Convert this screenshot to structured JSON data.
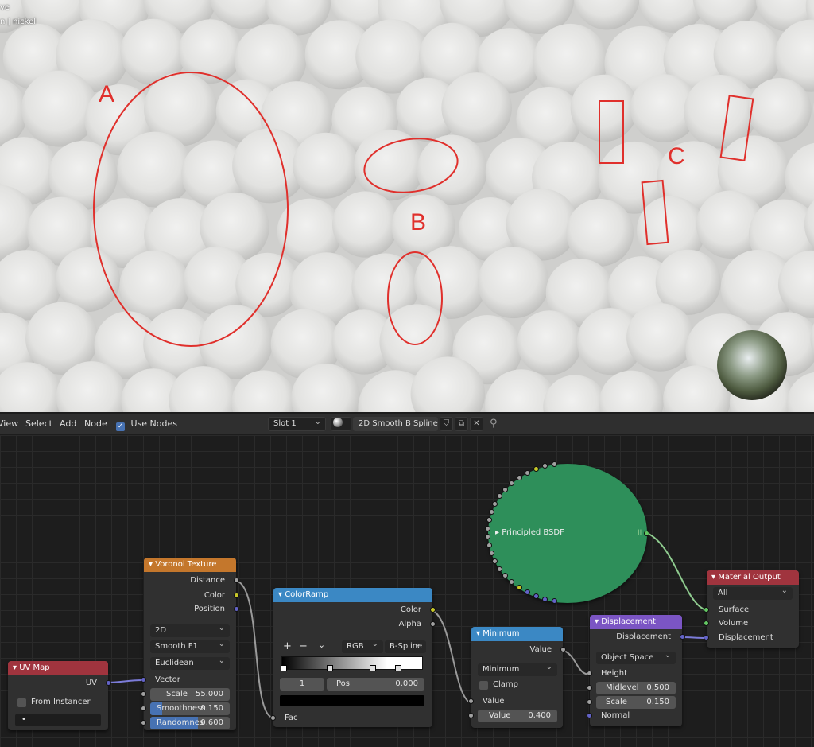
{
  "viewport": {
    "overlay_line1": "ve",
    "overlay_line2": "n | nickel",
    "annotations": {
      "a": "A",
      "b": "B",
      "c": "C"
    }
  },
  "header": {
    "menu": [
      "View",
      "Select",
      "Add",
      "Node"
    ],
    "use_nodes_label": "Use Nodes",
    "use_nodes_checked": true,
    "slot": "Slot 1",
    "material_name": "2D Smooth B Spline"
  },
  "nodes": {
    "uvmap": {
      "title": "UV Map",
      "out_uv": "UV",
      "from_instancer": "From Instancer",
      "field_value": "•"
    },
    "voronoi": {
      "title": "Voronoi Texture",
      "out_distance": "Distance",
      "out_color": "Color",
      "out_position": "Position",
      "dimensions": "2D",
      "feature": "Smooth F1",
      "metric": "Euclidean",
      "in_vector": "Vector",
      "scale_label": "Scale",
      "scale_value": "55.000",
      "smoothness_label": "Smoothness",
      "smoothness_value": "0.150",
      "smoothness_fraction": 0.15,
      "randomness_label": "Randomnes",
      "randomness_value": "0.600",
      "randomness_fraction": 0.6
    },
    "colorramp": {
      "title": "ColorRamp",
      "out_color": "Color",
      "out_alpha": "Alpha",
      "btn_add": "+",
      "btn_remove": "−",
      "btn_menu": "⌄",
      "color_mode": "RGB",
      "interpolation": "B-Spline",
      "stop_index": "1",
      "pos_label": "Pos",
      "pos_value": "0.000",
      "in_fac": "Fac"
    },
    "minimum": {
      "title": "Minimum",
      "out_value": "Value",
      "operation": "Minimum",
      "clamp_label": "Clamp",
      "in_value": "Value",
      "value_label": "Value",
      "value_value": "0.400"
    },
    "principled": {
      "title": "Principled BSDF",
      "collapsed_marker": "II"
    },
    "displacement": {
      "title": "Displacement",
      "out_displacement": "Displacement",
      "space": "Object Space",
      "in_height": "Height",
      "midlevel_label": "Midlevel",
      "midlevel_value": "0.500",
      "scale_label": "Scale",
      "scale_value": "0.150",
      "in_normal": "Normal"
    },
    "output": {
      "title": "Material Output",
      "target": "All",
      "in_surface": "Surface",
      "in_volume": "Volume",
      "in_displacement": "Displacement"
    }
  },
  "colors": {
    "accent": "#4772b3",
    "annotation": "#e0302c",
    "principled_green": "#2e8f5a",
    "header_input": "#a0343e",
    "header_texture": "#c4772c",
    "header_converter": "#3b88c4",
    "header_vector": "#7b55c4",
    "header_output": "#a0343e"
  }
}
